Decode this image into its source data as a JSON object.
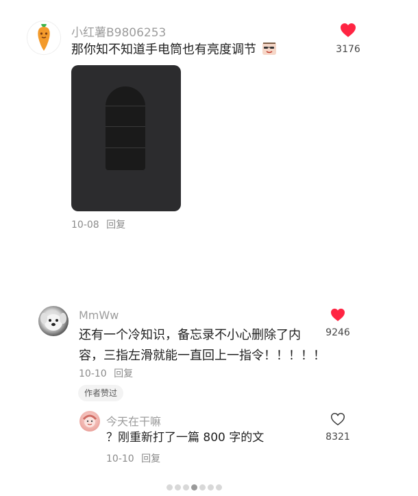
{
  "comments": [
    {
      "username": "小红薯B9806253",
      "text": "那你知不知道手电筒也有亮度调节",
      "date": "10-08",
      "reply_label": "回复",
      "likes": "3176",
      "liked": true
    },
    {
      "username": "MmWw",
      "text_line1": "还有一个冷知识，备忘录不小心删除了内",
      "text_line2": "容，三指左滑就能一直回上一指令！！！！！",
      "date": "10-10",
      "reply_label": "回复",
      "likes": "9246",
      "liked": true,
      "author_liked_tag": "作者赞过",
      "replies": [
        {
          "username": "今天在干嘛",
          "text": "？刚重新打了一篇 800 字的文",
          "date": "10-10",
          "reply_label": "回复",
          "likes": "8321",
          "liked": false
        }
      ]
    }
  ],
  "colors": {
    "heart_active": "#ff2442",
    "muted_text": "#9c9c9c"
  },
  "icons": [
    "carrot-avatar-icon",
    "heart-filled-icon",
    "heart-outline-icon",
    "sticker-emoji-icon"
  ]
}
